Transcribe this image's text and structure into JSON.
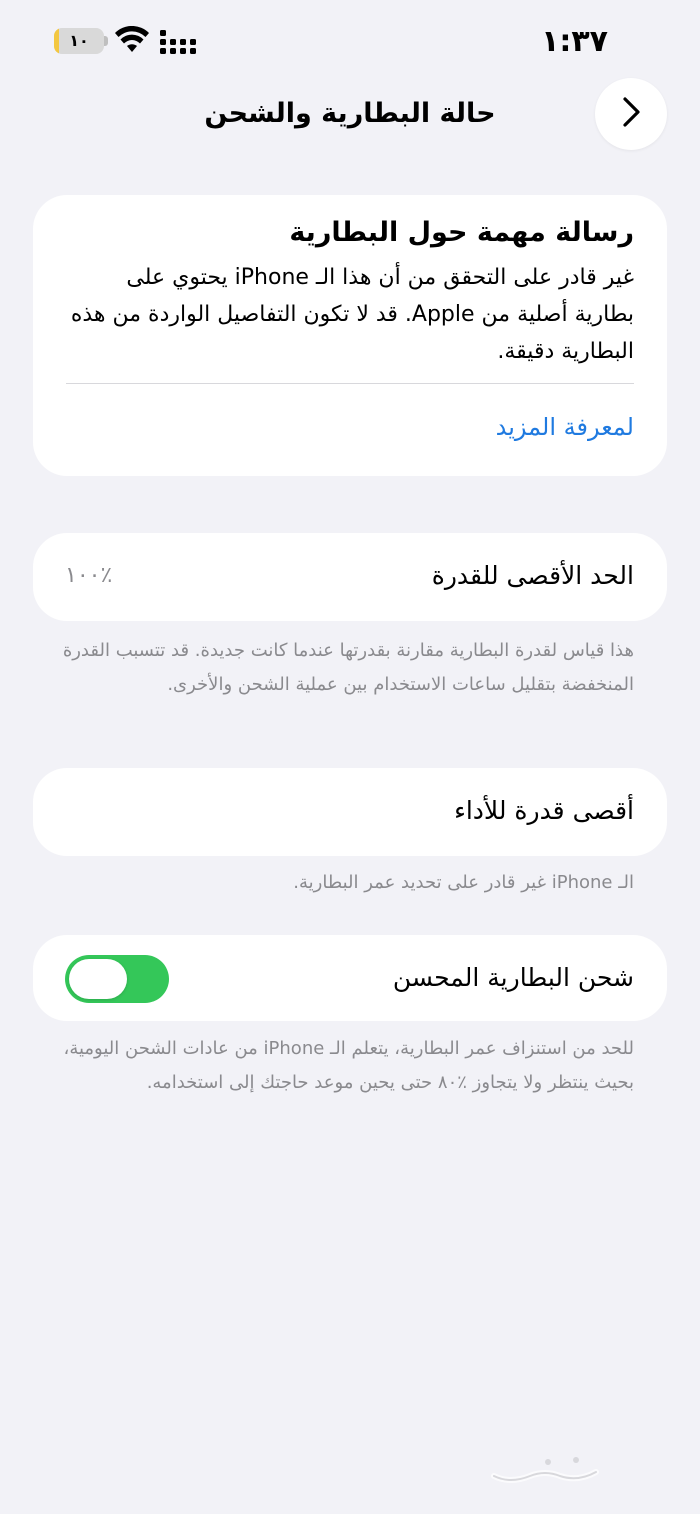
{
  "status_bar": {
    "time": "١:٣٧",
    "battery_text": "١٠",
    "battery_level": 0.1,
    "battery_color": "#f3c740"
  },
  "nav": {
    "title": "حالة البطارية والشحن",
    "back_icon": "chevron-right-icon"
  },
  "notice": {
    "title": "رسالة مهمة حول البطارية",
    "body": "غير قادر على التحقق من أن هذا الـ iPhone يحتوي على بطارية أصلية من Apple. قد لا تكون التفاصيل الواردة من هذه البطارية دقيقة.",
    "link": "لمعرفة المزيد",
    "link_color": "#1f7ae0"
  },
  "maximum_capacity": {
    "label": "الحد الأقصى للقدرة",
    "value": "٪١٠٠",
    "footnote": "هذا قياس لقدرة البطارية مقارنة بقدرتها عندما كانت جديدة. قد تتسبب القدرة المنخفضة بتقليل ساعات الاستخدام بين عملية الشحن والأخرى."
  },
  "peak_performance": {
    "label": "أقصى قدرة للأداء",
    "footnote": "الـ iPhone غير قادر على تحديد عمر البطارية."
  },
  "optimized_charging": {
    "label": "شحن البطارية المحسن",
    "enabled": true,
    "toggle_color": "#34c759",
    "footnote": "للحد من استنزاف عمر البطارية، يتعلم الـ iPhone من عادات الشحن اليومية، بحيث ينتظر ولا يتجاوز ٪٨٠ حتى يحين موعد حاجتك إلى استخدامه."
  },
  "watermark": {
    "text": "حراج"
  }
}
